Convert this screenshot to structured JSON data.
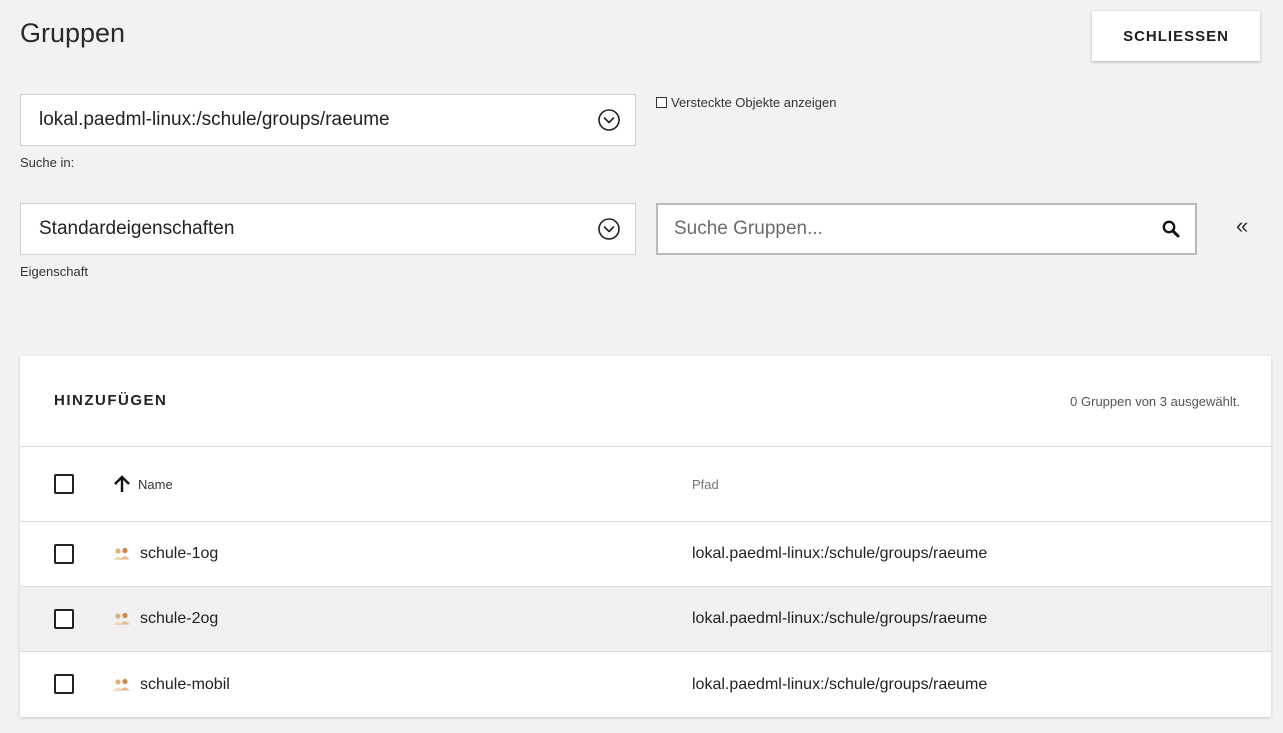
{
  "page": {
    "title": "Gruppen",
    "close_label": "SCHLIESSEN"
  },
  "search_in": {
    "value": "lokal.paedml-linux:/schule/groups/raeume",
    "label": "Suche in:",
    "icon": "chevron-down-circle-icon"
  },
  "hidden_objects": {
    "label": "Versteckte Objekte anzeigen",
    "checked": false
  },
  "property": {
    "value": "Standardeigenschaften",
    "label": "Eigenschaft",
    "icon": "chevron-down-circle-icon"
  },
  "search": {
    "placeholder": "Suche Gruppen...",
    "value": "",
    "icon": "search-icon"
  },
  "collapse": {
    "glyph": "«"
  },
  "grid": {
    "add_label": "HINZUFÜGEN",
    "selection_status": "0 Gruppen von 3 ausgewählt.",
    "columns": {
      "name": "Name",
      "path": "Pfad"
    },
    "sort": {
      "column": "name",
      "direction": "ascending",
      "icon": "arrow-up-icon"
    },
    "rows": [
      {
        "name": "schule-1og",
        "path": "lokal.paedml-linux:/schule/groups/raeume",
        "selected": false,
        "icon": "group-icon"
      },
      {
        "name": "schule-2og",
        "path": "lokal.paedml-linux:/schule/groups/raeume",
        "selected": false,
        "icon": "group-icon"
      },
      {
        "name": "schule-mobil",
        "path": "lokal.paedml-linux:/schule/groups/raeume",
        "selected": false,
        "icon": "group-icon"
      }
    ]
  },
  "colors": {
    "background": "#f2f2f2",
    "panel": "#ffffff",
    "row_hover": "#f0f0f0",
    "text": "#1e1e1e"
  }
}
